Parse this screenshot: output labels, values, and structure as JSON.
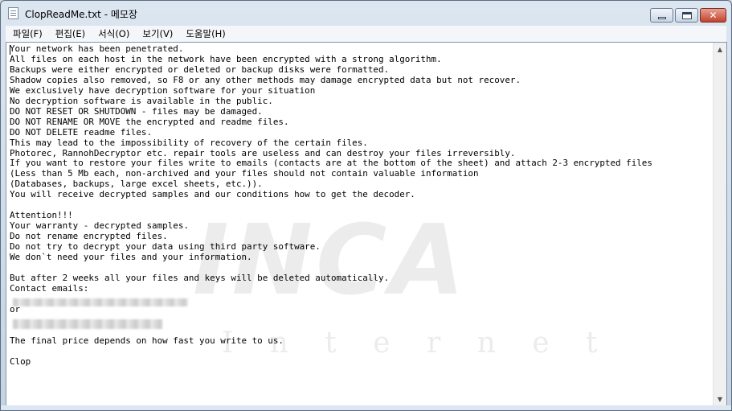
{
  "window": {
    "title": "ClopReadMe.txt - 메모장",
    "icon": "notepad-icon",
    "controls": {
      "minimize_icon": "minimize-icon",
      "maximize_icon": "maximize-icon",
      "close_icon": "close-icon",
      "close_glyph": "✕"
    }
  },
  "menu": [
    {
      "label": "파일(F)"
    },
    {
      "label": "편집(E)"
    },
    {
      "label": "서식(O)"
    },
    {
      "label": "보기(V)"
    },
    {
      "label": "도움말(H)"
    }
  ],
  "document": {
    "lines": [
      "Your network has been penetrated.",
      "All files on each host in the network have been encrypted with a strong algorithm.",
      "Backups were either encrypted or deleted or backup disks were formatted.",
      "Shadow copies also removed, so F8 or any other methods may damage encrypted data but not recover.",
      "We exclusively have decryption software for your situation",
      "No decryption software is available in the public.",
      "DO NOT RESET OR SHUTDOWN - files may be damaged.",
      "DO NOT RENAME OR MOVE the encrypted and readme files.",
      "DO NOT DELETE readme files.",
      "This may lead to the impossibility of recovery of the certain files.",
      "Photorec, RannohDecryptor etc. repair tools are useless and can destroy your files irreversibly.",
      "If you want to restore your files write to emails (contacts are at the bottom of the sheet) and attach 2-3 encrypted files",
      "(Less than 5 Mb each, non-archived and your files should not contain valuable information",
      "(Databases, backups, large excel sheets, etc.)).",
      "You will receive decrypted samples and our conditions how to get the decoder.",
      "",
      "Attention!!!",
      "Your warranty - decrypted samples.",
      "Do not rename encrypted files.",
      "Do not try to decrypt your data using third party software.",
      "We don`t need your files and your information.",
      "",
      "But after 2 weeks all your files and keys will be deleted automatically.",
      "Contact emails:",
      "",
      "or",
      "",
      "",
      "The final price depends on how fast you write to us.",
      "",
      "Clop"
    ]
  },
  "watermark": {
    "logo": "INCA",
    "subtitle": "Internet"
  },
  "scrollbar": {
    "up_icon": "scroll-up-icon",
    "down_icon": "scroll-down-icon",
    "up_glyph": "▲",
    "down_glyph": "▼"
  }
}
